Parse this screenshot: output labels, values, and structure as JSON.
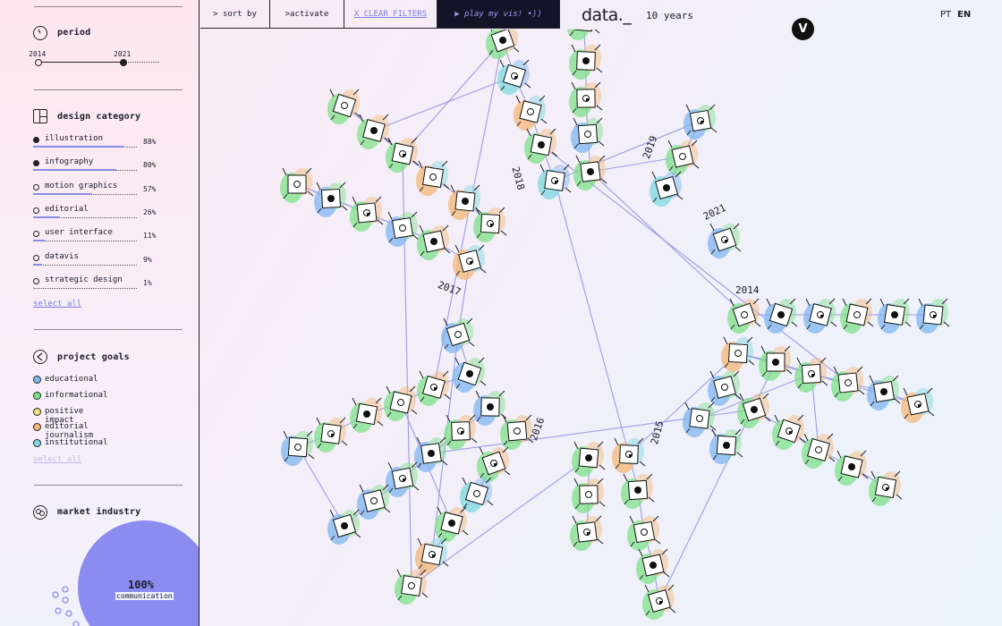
{
  "sidebar": {
    "period": {
      "title": "period",
      "start": "2014",
      "end": "2021"
    },
    "design_category": {
      "title": "design category",
      "items": [
        {
          "label": "illustration",
          "pct": "88%",
          "value": 0.88,
          "filled": true
        },
        {
          "label": "infography",
          "pct": "80%",
          "value": 0.8,
          "filled": true
        },
        {
          "label": "motion graphics",
          "pct": "57%",
          "value": 0.57,
          "filled": false
        },
        {
          "label": "editorial",
          "pct": "26%",
          "value": 0.26,
          "filled": false
        },
        {
          "label": "user interface",
          "pct": "11%",
          "value": 0.11,
          "filled": false
        },
        {
          "label": "datavis",
          "pct": "9%",
          "value": 0.09,
          "filled": false
        },
        {
          "label": "strategic design",
          "pct": "1%",
          "value": 0.01,
          "filled": false
        }
      ],
      "select_all": "select all"
    },
    "project_goals": {
      "title": "project goals",
      "items": [
        {
          "label": "educational",
          "color": "#7fb6f0"
        },
        {
          "label": "informational",
          "color": "#7fe08a"
        },
        {
          "label": "positive impact",
          "color": "#f2e27a"
        },
        {
          "label": "editorial journalism",
          "color": "#f4b777"
        },
        {
          "label": "institutional",
          "color": "#7fd8e0"
        }
      ],
      "select_all": "select all"
    },
    "market_industry": {
      "title": "market industry",
      "pct": "100%",
      "label": "communication",
      "color": "#8b8bf0"
    }
  },
  "toolbar": {
    "sort": "> sort by",
    "activate": ">activate",
    "clear": "X CLEAR FILTERS",
    "play": "▶  play my vis!  •))",
    "logo": "data._",
    "years": "10 years",
    "badge": "V",
    "lang_pt": "PT",
    "lang_en": "EN"
  },
  "viz": {
    "years": [
      "2014",
      "2015",
      "2016",
      "2017",
      "2018",
      "2019",
      "2021"
    ]
  }
}
